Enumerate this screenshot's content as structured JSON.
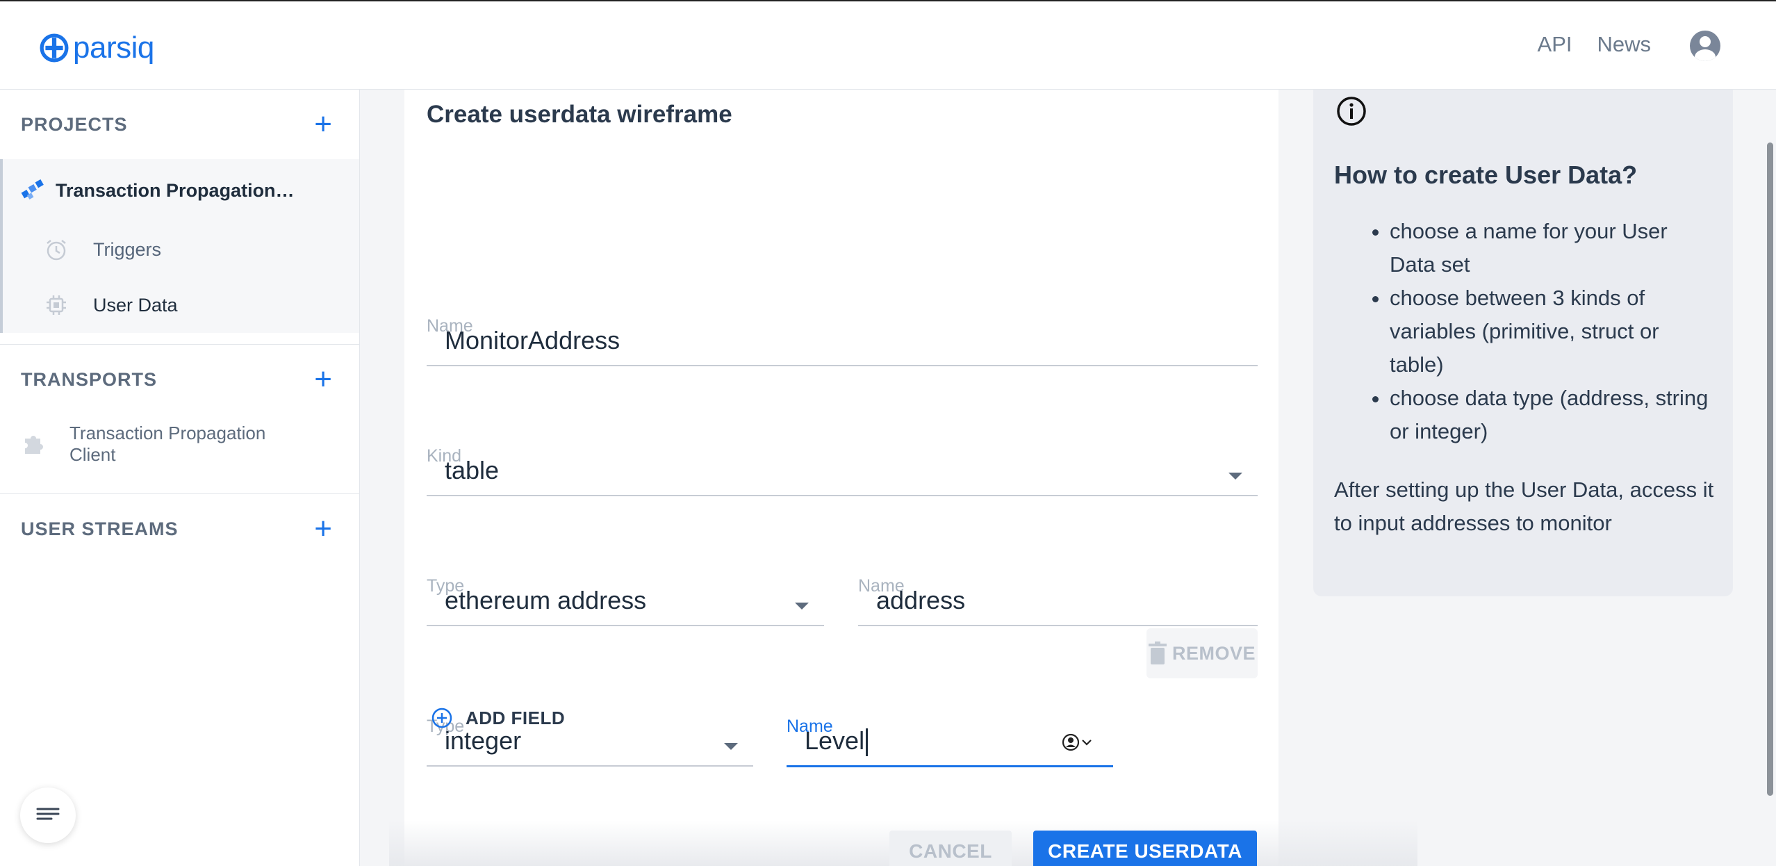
{
  "header": {
    "logo_text": "parsiq",
    "nav": [
      "API",
      "News"
    ]
  },
  "sidebar": {
    "projects_label": "PROJECTS",
    "project_name": "Transaction Propagation…",
    "items": [
      {
        "label": "Triggers",
        "icon": "alarm-clock-icon"
      },
      {
        "label": "User Data",
        "icon": "chip-icon"
      }
    ],
    "transports_label": "TRANSPORTS",
    "transport_name": "Transaction Propagation Client",
    "user_streams_label": "USER STREAMS"
  },
  "form": {
    "title": "Create userdata wireframe",
    "name_label": "Name",
    "name_value": "MonitorAddress",
    "kind_label": "Kind",
    "kind_value": "table",
    "field1": {
      "type_label": "Type",
      "type_value": "ethereum address",
      "name_label": "Name",
      "name_value": "address"
    },
    "field2": {
      "type_label": "Type",
      "type_value": "integer",
      "name_label": "Name",
      "name_value": "Level"
    },
    "remove_label": "REMOVE",
    "add_field_label": "ADD FIELD",
    "cancel_label": "CANCEL",
    "create_label": "CREATE USERDATA"
  },
  "info": {
    "title": "How to create User Data?",
    "bullets": [
      "choose a name for your User Data set",
      "choose between 3 kinds of variables (primitive, struct or table)",
      "choose data type (address, string or integer)"
    ],
    "footer": "After setting up the User Data, access it to input addresses to monitor"
  },
  "colors": {
    "accent": "#1a73e8",
    "panel": "#eaecf1"
  }
}
